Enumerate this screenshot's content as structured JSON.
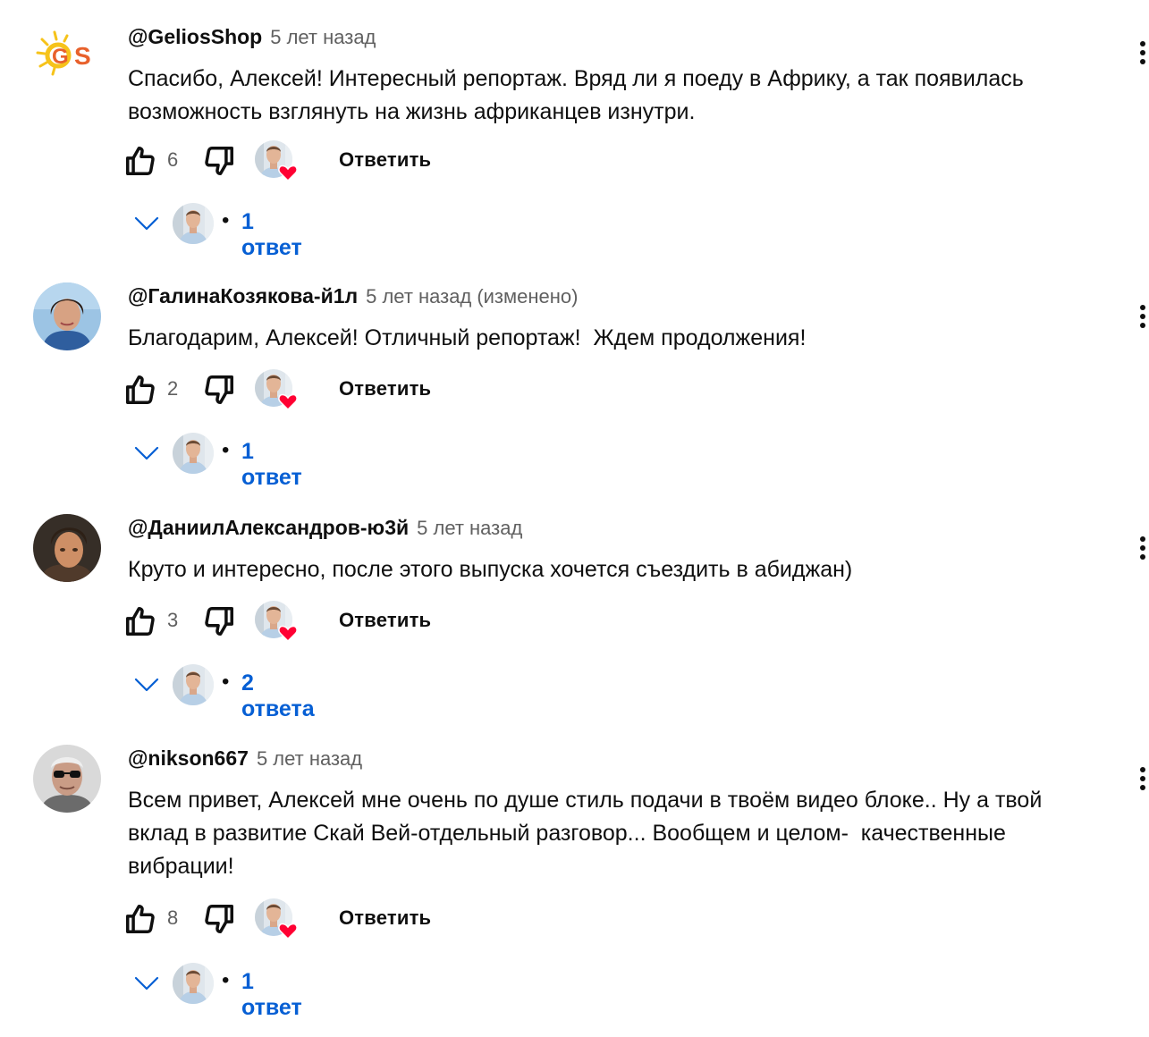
{
  "comments": [
    {
      "author": "@GeliosShop",
      "time": "5 лет назад",
      "edited": "",
      "text": "Спасибо, Алексей! Интересный репортаж. Вряд ли я поеду в Африку, а так появилась\nвозможность взглянуть на жизнь африканцев изнутри.",
      "likes": "6",
      "reply_label": "Ответить",
      "replies_label": "1 ответ",
      "avatar_icon": "gs-logo-avatar"
    },
    {
      "author": "@ГалинаКозякова-й1л",
      "time": "5 лет назад",
      "edited": "(изменено)",
      "text": "Благодарим, Алексей! Отличный репортаж!  Ждем продолжения!",
      "likes": "2",
      "reply_label": "Ответить",
      "replies_label": "1 ответ",
      "avatar_icon": "woman-portrait-avatar"
    },
    {
      "author": "@ДаниилАлександров-ю3й",
      "time": "5 лет назад",
      "edited": "",
      "text": "Круто и интересно, после этого выпуска хочется съездить в абиджан)",
      "likes": "3",
      "reply_label": "Ответить",
      "replies_label": "2 ответа",
      "avatar_icon": "man-portrait-avatar"
    },
    {
      "author": "@nikson667",
      "time": "5 лет назад",
      "edited": "",
      "text": "Всем привет, Алексей мне очень по душе стиль подачи в твоём видео блоке.. Ну а твой\nвклад в развитие Скай Вей-отдельный разговор... Вообщем и целом-  качественные\nвибрации!",
      "likes": "8",
      "reply_label": "Ответить",
      "replies_label": "1 ответ",
      "avatar_icon": "man-sunglasses-avatar"
    }
  ],
  "colors": {
    "link_blue": "#065fd4",
    "heart_red": "#ff0033",
    "meta_gray": "#606060",
    "text": "#0f0f0f"
  },
  "icons": {
    "like": "thumbs-up-icon",
    "dislike": "thumbs-down-icon",
    "creator_heart": "creator-heart-icon",
    "expand": "chevron-down-icon",
    "menu": "more-vertical-icon"
  }
}
